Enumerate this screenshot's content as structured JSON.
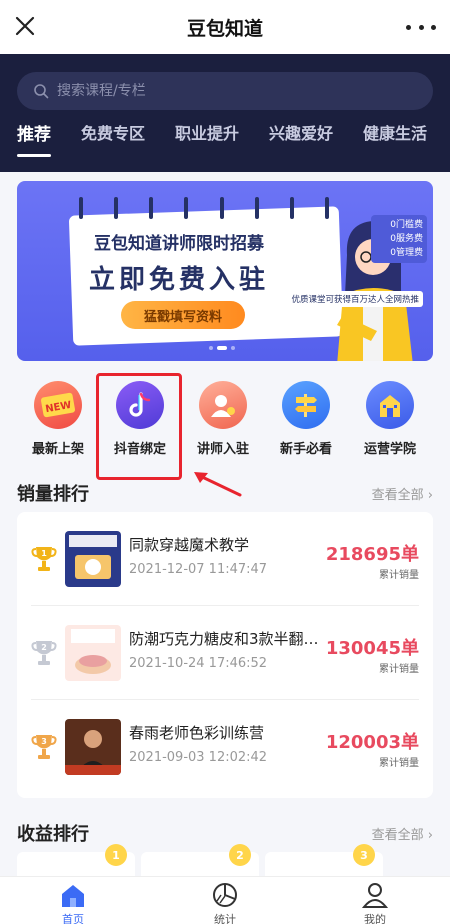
{
  "titlebar": {
    "title": "豆包知道"
  },
  "search": {
    "placeholder": "搜索课程/专栏"
  },
  "tabs": [
    {
      "label": "推荐",
      "active": true
    },
    {
      "label": "免费专区"
    },
    {
      "label": "职业提升"
    },
    {
      "label": "兴趣爱好"
    },
    {
      "label": "健康生活"
    }
  ],
  "banner": {
    "line1": "豆包知道讲师限时招募",
    "line2": "立即免费入驻",
    "button": "猛戳填写资料",
    "fees": [
      "0门槛费",
      "0服务费",
      "0管理费"
    ],
    "tag": "优质课堂可获得百万达人全网热推"
  },
  "quick_links": [
    {
      "label": "最新上架",
      "icon": "new-badge-icon",
      "badge_text": "NEW"
    },
    {
      "label": "抖音绑定",
      "icon": "douyin-icon"
    },
    {
      "label": "讲师入驻",
      "icon": "lecturer-icon"
    },
    {
      "label": "新手必看",
      "icon": "signpost-icon"
    },
    {
      "label": "运营学院",
      "icon": "school-icon"
    }
  ],
  "sales_ranking": {
    "title": "销量排行",
    "view_all": "查看全部",
    "items": [
      {
        "rank": 1,
        "name": "同款穿越魔术教学",
        "date": "2021-12-07 11:47:47",
        "count": "218695单",
        "sub": "累计销量",
        "trophy_color": "#f2b418"
      },
      {
        "rank": 2,
        "name": "防潮巧克力糖皮和3款半翻糖...",
        "date": "2021-10-24 17:46:52",
        "count": "130045单",
        "sub": "累计销量",
        "trophy_color": "#c5c9d3"
      },
      {
        "rank": 3,
        "name": "春雨老师色彩训练营",
        "date": "2021-09-03 12:02:42",
        "count": "120003单",
        "sub": "累计销量",
        "trophy_color": "#f0a64a"
      }
    ]
  },
  "revenue_ranking": {
    "title": "收益排行",
    "view_all": "查看全部"
  },
  "bottom_nav": [
    {
      "label": "首页",
      "icon": "home-icon",
      "active": true
    },
    {
      "label": "统计",
      "icon": "chart-icon"
    },
    {
      "label": "我的",
      "icon": "profile-icon"
    }
  ],
  "colors": {
    "header_bg": "#1b1f3e",
    "accent": "#3b6bf5",
    "count_red": "#e84a5f",
    "highlight_red": "#e8242e"
  }
}
